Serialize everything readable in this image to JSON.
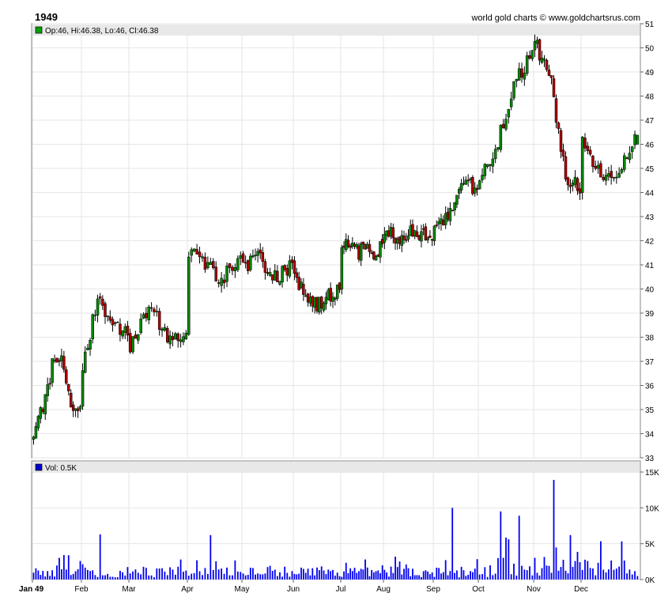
{
  "header": {
    "title": "1949",
    "credit": "world gold charts © www.goldchartsrus.com"
  },
  "price_panel": {
    "legend": "Op:46, Hi:46.38, Lo:46, Cl:46.38",
    "legend_color": "#00a000"
  },
  "volume_panel": {
    "legend": "Vol: 0.5K",
    "legend_color": "#0000cc"
  },
  "colors": {
    "up": "#008800",
    "down": "#aa0000",
    "volume": "#0000ee",
    "grid": "#e6e6e6",
    "legend_bar": "#e8e8e8"
  },
  "chart_data": [
    {
      "type": "candlestick",
      "title": "1949",
      "ylim": [
        33,
        51
      ],
      "y_ticks": [
        33,
        34,
        35,
        36,
        37,
        38,
        39,
        40,
        41,
        42,
        43,
        44,
        45,
        46,
        47,
        48,
        49,
        50,
        51
      ],
      "x_tick_labels": [
        "Jan 49",
        "Feb",
        "Mar",
        "Apr",
        "May",
        "Jun",
        "Jul",
        "Aug",
        "Sep",
        "Oct",
        "Nov",
        "Dec"
      ],
      "grid": true,
      "legend": "top-left",
      "last_bar": {
        "open": 46,
        "high": 46.38,
        "low": 46,
        "close": 46.38
      },
      "monthly_close_path": [
        {
          "month": "Jan",
          "close": [
            34.2,
            35.0,
            36.8,
            37.2,
            35.4,
            35.0
          ]
        },
        {
          "month": "Feb",
          "close": [
            36.6,
            39.6,
            38.5,
            38.4
          ]
        },
        {
          "month": "Mar",
          "close": [
            37.4,
            39.4,
            38.0,
            38.3
          ]
        },
        {
          "month": "Apr",
          "close": [
            41.5,
            41.0,
            40.4,
            41.5
          ]
        },
        {
          "month": "May",
          "close": [
            40.8,
            41.3,
            40.5,
            40.9
          ]
        },
        {
          "month": "Jun",
          "close": [
            40.6,
            39.3,
            39.5,
            40.0
          ]
        },
        {
          "month": "Jul",
          "close": [
            41.8,
            41.6,
            41.5,
            41.7
          ]
        },
        {
          "month": "Aug",
          "close": [
            42.3,
            42.1,
            42.4,
            42.2
          ]
        },
        {
          "month": "Sep",
          "close": [
            42.4,
            43.2,
            44.6,
            44.1
          ]
        },
        {
          "month": "Oct",
          "close": [
            44.5,
            46.0,
            48.5,
            49.8
          ]
        },
        {
          "month": "Nov",
          "close": [
            50.2,
            49.0,
            44.8,
            44.1
          ]
        },
        {
          "month": "Dec",
          "close": [
            46.0,
            44.8,
            45.0,
            46.38
          ]
        }
      ]
    },
    {
      "type": "bar",
      "title": "Vol",
      "ylim": [
        0,
        15000
      ],
      "y_ticks": [
        0,
        5000,
        10000,
        15000
      ],
      "y_tick_labels": [
        "0K",
        "5K",
        "10K",
        "15K"
      ],
      "last_value": 500,
      "notable_spikes": [
        {
          "month": "Feb",
          "value": 6300
        },
        {
          "month": "Apr",
          "value": 6200
        },
        {
          "month": "Sep",
          "value": 10000
        },
        {
          "month": "Oct",
          "value": 9500
        },
        {
          "month": "Oct",
          "value": 8900
        },
        {
          "month": "Nov",
          "value": 13900
        },
        {
          "month": "Nov",
          "value": 6200
        }
      ]
    }
  ]
}
